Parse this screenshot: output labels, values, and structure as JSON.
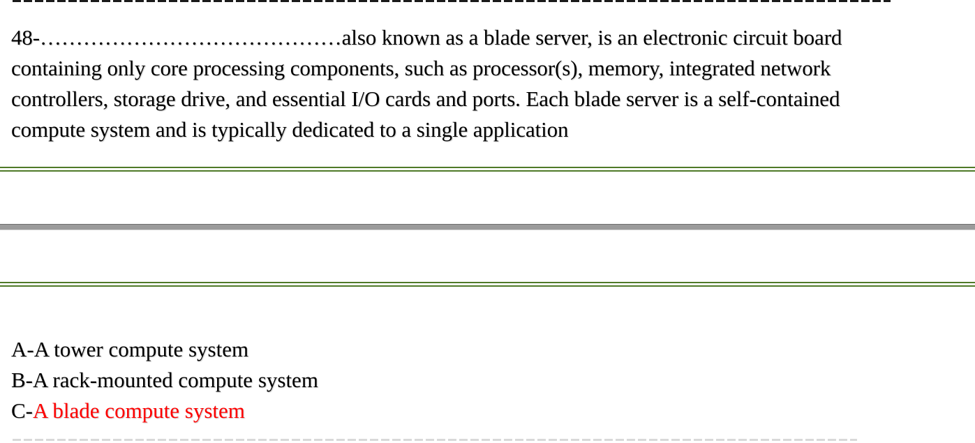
{
  "question": {
    "number": "48-",
    "blank": "……………………………………",
    "text": "also known as a blade server, is an electronic circuit board containing only core processing components, such as processor(s), memory, integrated network controllers, storage drive, and essential I/O cards and ports. Each blade server is a self-contained compute system and is typically dedicated to a single application"
  },
  "options": [
    {
      "prefix": "A-",
      "text": "A tower compute system"
    },
    {
      "prefix": "B-",
      "text": "A rack-mounted compute system"
    },
    {
      "prefix": "C-",
      "text": "A blade compute system"
    }
  ],
  "colors": {
    "answer": "#ff0000",
    "rule_green": "#4f7a28",
    "rule_gray": "#9b9b9b"
  }
}
